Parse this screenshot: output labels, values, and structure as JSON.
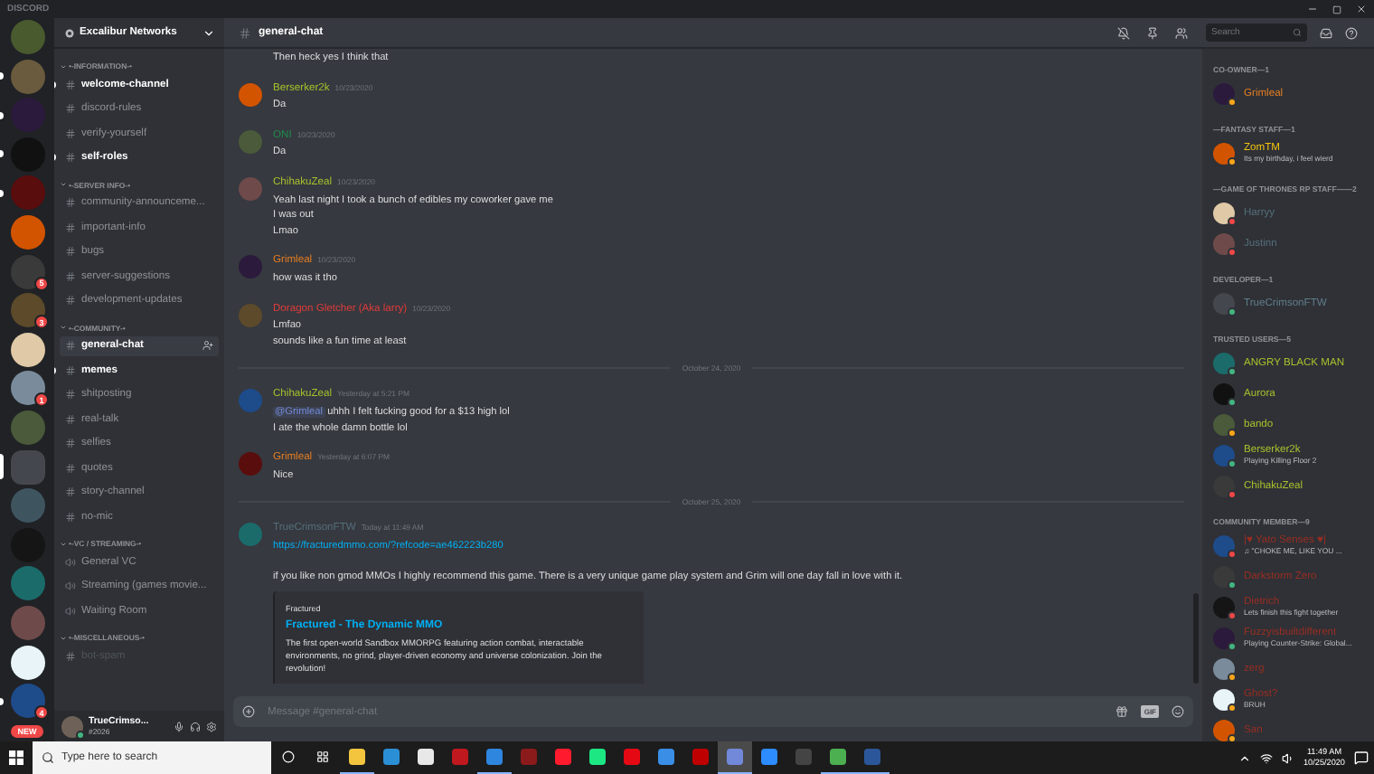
{
  "window": {
    "title": "DISCORD"
  },
  "servers": [
    {
      "unread": false,
      "selected": false
    },
    {
      "unread": true,
      "selected": false
    },
    {
      "unread": true,
      "selected": false
    },
    {
      "unread": true,
      "selected": false
    },
    {
      "unread": true,
      "selected": false
    },
    {
      "unread": false,
      "selected": false
    },
    {
      "unread": false,
      "selected": false,
      "badge": "5"
    },
    {
      "unread": false,
      "selected": false,
      "badge": "3"
    },
    {
      "unread": false,
      "selected": false
    },
    {
      "unread": false,
      "selected": false,
      "badge": "1"
    },
    {
      "unread": false,
      "selected": false
    },
    {
      "unread": false,
      "selected": true
    },
    {
      "unread": false,
      "selected": false
    },
    {
      "unread": false,
      "selected": false
    },
    {
      "unread": false,
      "selected": false
    },
    {
      "unread": false,
      "selected": false
    },
    {
      "unread": false,
      "selected": false
    },
    {
      "unread": true,
      "selected": false,
      "badge": "4"
    }
  ],
  "new_label": "NEW",
  "guild": {
    "name": "Excalibur Networks"
  },
  "categories": [
    {
      "name": "•-INFORMATION-•",
      "expanded": true,
      "channels": [
        {
          "name": "welcome-channel",
          "kind": "text",
          "unread": true,
          "selected": false,
          "muted": false
        },
        {
          "name": "discord-rules",
          "kind": "text",
          "unread": false,
          "selected": false,
          "muted": false
        },
        {
          "name": "verify-yourself",
          "kind": "text",
          "unread": false,
          "selected": false,
          "muted": false
        },
        {
          "name": "self-roles",
          "kind": "text",
          "unread": true,
          "selected": false,
          "muted": false
        }
      ]
    },
    {
      "name": "•-SERVER INFO-•",
      "expanded": true,
      "channels": [
        {
          "name": "community-announceme...",
          "kind": "text",
          "unread": false,
          "selected": false,
          "muted": false
        },
        {
          "name": "important-info",
          "kind": "text",
          "unread": false,
          "selected": false,
          "muted": false
        },
        {
          "name": "bugs",
          "kind": "text",
          "unread": false,
          "selected": false,
          "muted": false
        },
        {
          "name": "server-suggestions",
          "kind": "text",
          "unread": false,
          "selected": false,
          "muted": false
        },
        {
          "name": "development-updates",
          "kind": "text",
          "unread": false,
          "selected": false,
          "muted": false
        }
      ]
    },
    {
      "name": "•-COMMUNITY-•",
      "expanded": true,
      "channels": [
        {
          "name": "general-chat",
          "kind": "text",
          "unread": false,
          "selected": true,
          "muted": false
        },
        {
          "name": "memes",
          "kind": "text",
          "unread": true,
          "selected": false,
          "muted": false
        },
        {
          "name": "shitposting",
          "kind": "text",
          "unread": false,
          "selected": false,
          "muted": false
        },
        {
          "name": "real-talk",
          "kind": "text",
          "unread": false,
          "selected": false,
          "muted": false
        },
        {
          "name": "selfies",
          "kind": "text",
          "unread": false,
          "selected": false,
          "muted": false
        },
        {
          "name": "quotes",
          "kind": "text",
          "unread": false,
          "selected": false,
          "muted": false
        },
        {
          "name": "story-channel",
          "kind": "text",
          "unread": false,
          "selected": false,
          "muted": false
        },
        {
          "name": "no-mic",
          "kind": "text",
          "unread": false,
          "selected": false,
          "muted": false
        }
      ]
    },
    {
      "name": "•-VC / STREAMING-•",
      "expanded": true,
      "channels": [
        {
          "name": "General VC",
          "kind": "voice",
          "unread": false,
          "selected": false,
          "muted": false
        },
        {
          "name": "Streaming (games movie...",
          "kind": "voice",
          "unread": false,
          "selected": false,
          "muted": false
        },
        {
          "name": "Waiting Room",
          "kind": "voice",
          "unread": false,
          "selected": false,
          "muted": false
        }
      ]
    },
    {
      "name": "•-MISCELLANEOUS-•",
      "expanded": true,
      "channels": [
        {
          "name": "bot-spam",
          "kind": "text",
          "unread": false,
          "selected": false,
          "muted": true
        }
      ]
    }
  ],
  "user": {
    "name": "TrueCrimso...",
    "tag": "#2026",
    "kind": "online"
  },
  "chat": {
    "channel": "general-chat",
    "messages": [
      {
        "kind": "continued",
        "lines": [
          {
            "kind": "text",
            "text": "Then heck yes I think that"
          }
        ]
      },
      {
        "kind": "message",
        "author": "Berserker2k",
        "color": "#a6c12d",
        "time": "10/23/2020",
        "lines": [
          {
            "kind": "text",
            "text": "Da"
          }
        ]
      },
      {
        "kind": "message",
        "author": "ONI",
        "color": "#1f8b4c",
        "time": "10/23/2020",
        "lines": [
          {
            "kind": "text",
            "text": "Da"
          }
        ]
      },
      {
        "kind": "message",
        "author": "ChihakuZeal",
        "color": "#a6c12d",
        "time": "10/23/2020",
        "lines": [
          {
            "kind": "text",
            "text": "Yeah last night I took a bunch of edibles my coworker gave me"
          },
          {
            "kind": "text",
            "text": "I was out"
          },
          {
            "kind": "text",
            "text": "Lmao"
          }
        ]
      },
      {
        "kind": "message",
        "author": "Grimleal",
        "color": "#e67e22",
        "time": "10/23/2020",
        "lines": [
          {
            "kind": "text",
            "text": "how was it tho"
          }
        ]
      },
      {
        "kind": "message",
        "author": "Doragon Gletcher (Aka larry)",
        "color": "#e03b3b",
        "time": "10/23/2020",
        "lines": [
          {
            "kind": "text",
            "text": "Lmfao"
          },
          {
            "kind": "text",
            "text": "sounds like a fun time at least"
          }
        ]
      },
      {
        "kind": "divider",
        "text": "October 24, 2020"
      },
      {
        "kind": "message",
        "author": "ChihakuZeal",
        "color": "#a6c12d",
        "time": "Yesterday at 5:21 PM",
        "lines": [
          {
            "kind": "mention",
            "mention": "@Grimleal",
            "text": "uhhh I felt fucking good for a $13 high lol"
          },
          {
            "kind": "text",
            "text": "I ate the whole damn bottle lol"
          }
        ]
      },
      {
        "kind": "message",
        "author": "Grimleal",
        "color": "#e67e22",
        "time": "Yesterday at 6:07 PM",
        "lines": [
          {
            "kind": "text",
            "text": "Nice"
          }
        ]
      },
      {
        "kind": "divider",
        "text": "October 25, 2020"
      },
      {
        "kind": "message",
        "author": "TrueCrimsonFTW",
        "color": "#546e7a",
        "time": "Today at 11:49 AM",
        "lines": [
          {
            "kind": "link",
            "text": "https://fracturedmmo.com/?refcode=ae462223b280"
          },
          {
            "kind": "paragraph",
            "text": "if you like non gmod MMOs I highly recommend this game. There is a very unique game play system and Grim will one day fall in love with it."
          }
        ],
        "embed": {
          "provider": "Fractured",
          "title": "Fractured - The Dynamic MMO",
          "description": "The first open-world Sandbox MMORPG featuring action combat, interactable environments, no grind, player-driven economy and universe colonization. Join the revolution!"
        }
      }
    ],
    "input": {
      "placeholder": "Message #general-chat",
      "gif": "GIF"
    }
  },
  "search": {
    "placeholder": "Search"
  },
  "member_groups": [
    {
      "title": "CO-OWNER—1",
      "members": [
        {
          "name": "Grimleal",
          "color": "#e67e22",
          "kind": "idle"
        }
      ]
    },
    {
      "title": "—FANTASY STAFF—1",
      "members": [
        {
          "name": "ZomTM",
          "color": "#f1c40f",
          "kind": "idle",
          "activity": "Its my birthday, i feel wierd"
        }
      ]
    },
    {
      "title": "—GAME OF THRONES RP STAFF——2",
      "members": [
        {
          "name": "Harryy",
          "color": "#546e7a",
          "kind": "dnd"
        },
        {
          "name": "Justinn",
          "color": "#546e7a",
          "kind": "dnd"
        }
      ]
    },
    {
      "title": "DEVELOPER—1",
      "members": [
        {
          "name": "TrueCrimsonFTW",
          "color": "#607d8b",
          "kind": "online"
        }
      ]
    },
    {
      "title": "TRUSTED USERS—5",
      "members": [
        {
          "name": "ANGRY BLACK MAN",
          "color": "#a6c12d",
          "kind": "online"
        },
        {
          "name": "Aurora",
          "color": "#a6c12d",
          "kind": "online"
        },
        {
          "name": "bando",
          "color": "#a6c12d",
          "kind": "idle"
        },
        {
          "name": "Berserker2k",
          "color": "#a6c12d",
          "kind": "online",
          "activity": "Playing Killing Floor 2"
        },
        {
          "name": "ChihakuZeal",
          "color": "#a6c12d",
          "kind": "dnd"
        }
      ]
    },
    {
      "title": "COMMUNITY MEMBER—9",
      "members": [
        {
          "name": "|♥ Yato Senses ♥|",
          "color": "#992d22",
          "kind": "dnd",
          "activity": "♫ \"CHOKE ME, LIKE YOU ..."
        },
        {
          "name": "Darkstorm Zero",
          "color": "#992d22",
          "kind": "online"
        },
        {
          "name": "Dietrich",
          "color": "#992d22",
          "kind": "dnd",
          "activity": "Lets finish this fight together"
        },
        {
          "name": "Fuzzyisbuiltdifferent",
          "color": "#992d22",
          "kind": "online",
          "activity": "Playing Counter-Strike: Global..."
        },
        {
          "name": "zerg",
          "color": "#992d22",
          "kind": "idle"
        },
        {
          "name": "Ghost?",
          "color": "#992d22",
          "kind": "idle",
          "activity": "BRUH"
        },
        {
          "name": "San",
          "color": "#992d22",
          "kind": "idle"
        }
      ]
    }
  ],
  "taskbar": {
    "search_placeholder": "Type here to search",
    "apps": [
      {
        "running": true,
        "active": false
      },
      {
        "running": false,
        "active": false
      },
      {
        "running": false,
        "active": false
      },
      {
        "running": false,
        "active": false
      },
      {
        "running": true,
        "active": false
      },
      {
        "running": false,
        "active": false
      },
      {
        "running": false,
        "active": false
      },
      {
        "running": false,
        "active": false
      },
      {
        "running": false,
        "active": false
      },
      {
        "running": false,
        "active": false
      },
      {
        "running": false,
        "active": false
      },
      {
        "running": true,
        "active": true
      },
      {
        "running": false,
        "active": false
      },
      {
        "running": false,
        "active": false
      },
      {
        "running": true,
        "active": false
      },
      {
        "running": true,
        "active": false
      }
    ],
    "time": "11:49 AM",
    "date": "10/25/2020"
  }
}
